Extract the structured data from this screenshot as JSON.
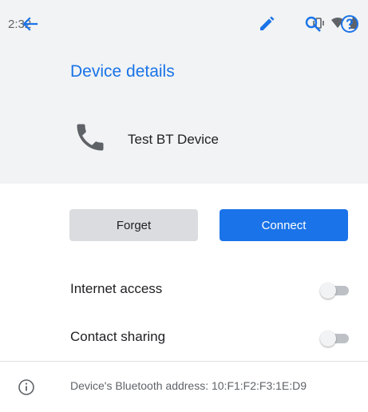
{
  "status_bar": {
    "time": "2:32",
    "icons": [
      "vibrate-icon",
      "wifi-icon",
      "battery-icon"
    ]
  },
  "app_bar": {
    "back_icon": "arrow-back-icon",
    "title": "Device details",
    "actions": [
      "edit-icon",
      "search-icon",
      "help-icon"
    ],
    "accent_color": "#1a73e8"
  },
  "device": {
    "icon": "phone-icon",
    "name": "Test BT Device"
  },
  "buttons": {
    "forget_label": "Forget",
    "connect_label": "Connect"
  },
  "settings": [
    {
      "label": "Internet access",
      "enabled": false
    },
    {
      "label": "Contact sharing",
      "enabled": false
    }
  ],
  "footer": {
    "icon": "info-icon",
    "text": "Device's Bluetooth address: 10:F1:F2:F3:1E:D9"
  }
}
